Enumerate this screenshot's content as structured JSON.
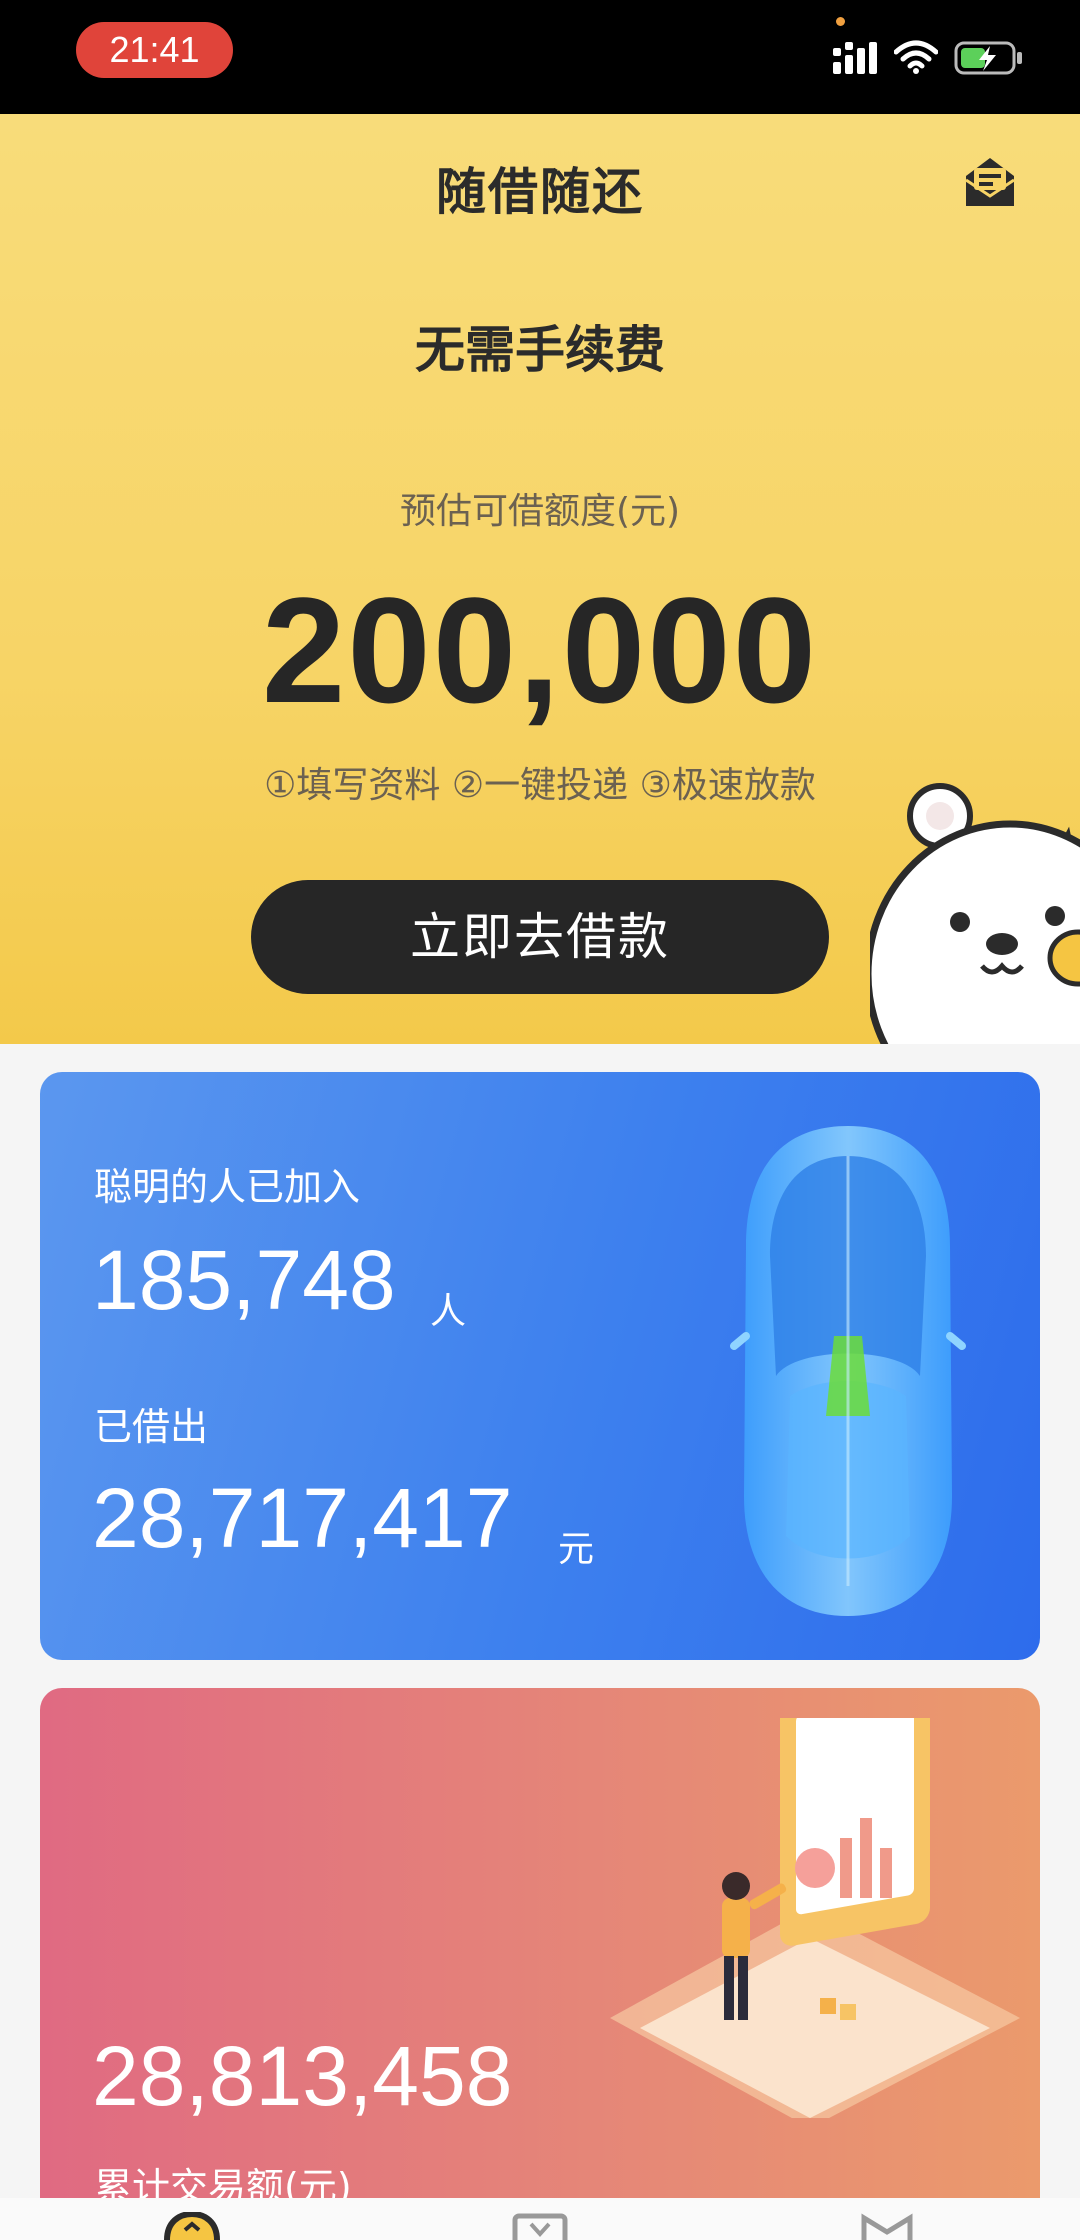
{
  "status_bar": {
    "time": "21:41",
    "icons": [
      "signal-icon",
      "wifi-icon",
      "battery-charging-icon"
    ]
  },
  "header": {
    "title": "随借随还",
    "mail_icon": "mail-icon"
  },
  "hero": {
    "subtitle": "无需手续费",
    "quota_label": "预估可借额度(元)",
    "amount": "200,000",
    "steps": "①填写资料 ②一键投递 ③极速放款",
    "cta_label": "立即去借款",
    "mascot": "bear-mascot-icon"
  },
  "stats_card": {
    "joined_label": "聪明的人已加入",
    "joined_count": "185,748",
    "joined_unit": "人",
    "lent_label": "已借出",
    "lent_amount": "28,717,417",
    "lent_unit": "元",
    "image": "car-illustration-icon"
  },
  "volume_card": {
    "total": "28,813,458",
    "label": "累计交易额(元)",
    "image": "isometric-phone-illustration-icon"
  },
  "colors": {
    "hero_yellow": "#f7d466",
    "button_dark": "#262626",
    "card_blue": "#3d80ee",
    "card_pink": "#e58678",
    "time_pill": "#e0443a"
  },
  "tabbar": {
    "icons": [
      "home-icon",
      "loan-icon",
      "mine-icon"
    ]
  }
}
